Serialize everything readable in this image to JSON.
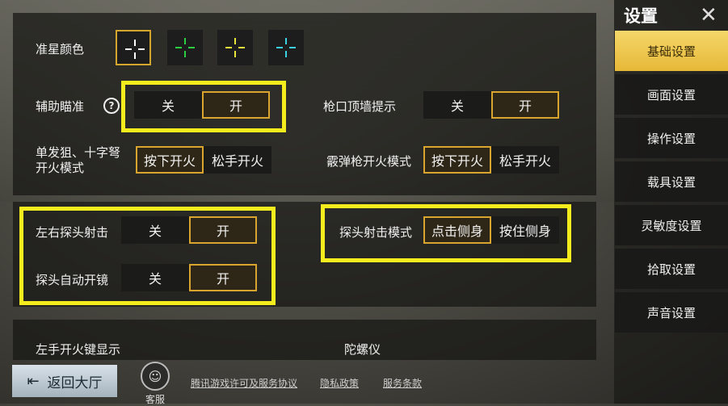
{
  "sidebar": {
    "title": "设置",
    "close_icon": "close-icon",
    "tabs": [
      {
        "label": "基础设置",
        "active": true
      },
      {
        "label": "画面设置"
      },
      {
        "label": "操作设置"
      },
      {
        "label": "载具设置"
      },
      {
        "label": "灵敏度设置"
      },
      {
        "label": "拾取设置"
      },
      {
        "label": "声音设置"
      }
    ]
  },
  "crosshair": {
    "label": "准星颜色",
    "colors": [
      "#ffffff",
      "#2ecc40",
      "#e8e63a",
      "#3ad0e6"
    ],
    "selected_index": 0
  },
  "aim_assist": {
    "label": "辅助瞄准",
    "help_icon": "help-icon",
    "off": "关",
    "on": "开",
    "selected": "on"
  },
  "muzzle_wall": {
    "label": "枪口顶墙提示",
    "off": "关",
    "on": "开",
    "selected": "on"
  },
  "single_fire": {
    "label_line1": "单发狙、十字弩",
    "label_line2": "开火模式",
    "opt1": "按下开火",
    "opt2": "松手开火",
    "selected": "opt1"
  },
  "shotgun_fire": {
    "label": "霰弹枪开火模式",
    "opt1": "按下开火",
    "opt2": "松手开火",
    "selected": "opt1"
  },
  "peek_fire": {
    "label": "左右探头射击",
    "off": "关",
    "on": "开",
    "selected": "on"
  },
  "peek_scope": {
    "label": "探头自动开镜",
    "off": "关",
    "on": "开",
    "selected": "on"
  },
  "peek_mode": {
    "label": "探头射击模式",
    "opt1": "点击侧身",
    "opt2": "按住侧身",
    "selected": "opt1"
  },
  "left_fire": {
    "label": "左手开火键显示"
  },
  "gyro": {
    "label": "陀螺仪"
  },
  "footer": {
    "back_label": "返回大厅",
    "service_label": "客服",
    "links": [
      "腾讯游戏许可及服务协议",
      "隐私政策",
      "服务条款"
    ]
  },
  "colors": {
    "accent_gold": "#d9a52e",
    "highlight_yellow": "#f4ec1c",
    "active_tab": "#e6b837"
  }
}
